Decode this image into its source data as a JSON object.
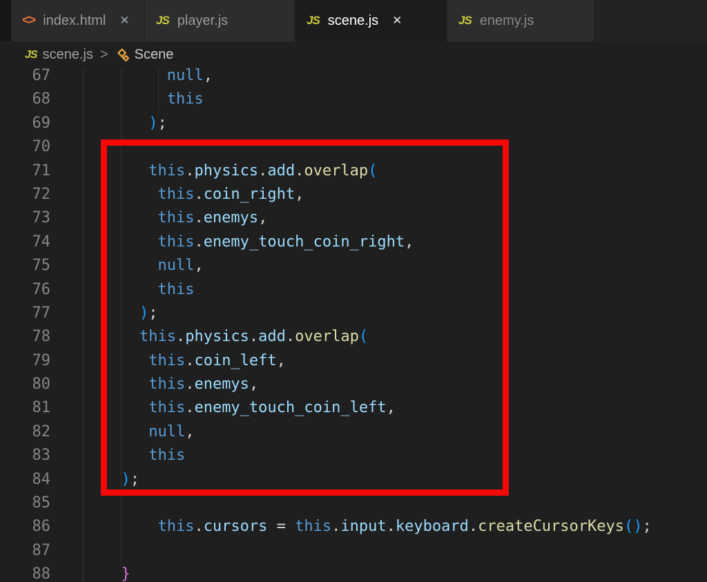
{
  "tab_bar": {
    "close_glyph": "✕",
    "js_icon_text": "JS",
    "html_icon_text": "<>",
    "tabs": [
      {
        "label": "index.html",
        "icon": "html-brackets",
        "close_visible": true,
        "active": false
      },
      {
        "label": "player.js",
        "icon": "js",
        "close_visible": false,
        "active": false
      },
      {
        "label": "scene.js",
        "icon": "js",
        "close_visible": true,
        "active": true
      },
      {
        "label": "enemy.js",
        "icon": "js",
        "close_visible": false,
        "active": false
      }
    ]
  },
  "breadcrumb": {
    "file_icon_text": "JS",
    "file_label": "scene.js",
    "chevron": ">",
    "symbol_label": "Scene"
  },
  "editor": {
    "background": "#1f1f1f",
    "line_number_color": "#858585",
    "first_visible_line": 67,
    "last_visible_line": 88,
    "token_colors": {
      "kw": "#569cd6",
      "prop": "#9cdcfe",
      "fn": "#dcdcaa",
      "pun": "#d4d4d4",
      "par": "#179fff",
      "brc": "#da70d6"
    },
    "lines": [
      {
        "num": 67,
        "indent": 11,
        "tokens": [
          [
            "kw",
            "null"
          ],
          [
            "pun",
            ","
          ]
        ]
      },
      {
        "num": 68,
        "indent": 11,
        "tokens": [
          [
            "kw",
            "this"
          ]
        ]
      },
      {
        "num": 69,
        "indent": 9,
        "tokens": [
          [
            "par",
            ")"
          ],
          [
            "pun",
            ";"
          ]
        ]
      },
      {
        "num": 70,
        "indent": 0,
        "tokens": []
      },
      {
        "num": 71,
        "indent": 9,
        "tokens": [
          [
            "kw",
            "this"
          ],
          [
            "pun",
            "."
          ],
          [
            "prop",
            "physics"
          ],
          [
            "pun",
            "."
          ],
          [
            "prop",
            "add"
          ],
          [
            "pun",
            "."
          ],
          [
            "fn",
            "overlap"
          ],
          [
            "par",
            "("
          ]
        ]
      },
      {
        "num": 72,
        "indent": 10,
        "tokens": [
          [
            "kw",
            "this"
          ],
          [
            "pun",
            "."
          ],
          [
            "prop",
            "coin_right"
          ],
          [
            "pun",
            ","
          ]
        ]
      },
      {
        "num": 73,
        "indent": 10,
        "tokens": [
          [
            "kw",
            "this"
          ],
          [
            "pun",
            "."
          ],
          [
            "prop",
            "enemys"
          ],
          [
            "pun",
            ","
          ]
        ]
      },
      {
        "num": 74,
        "indent": 10,
        "tokens": [
          [
            "kw",
            "this"
          ],
          [
            "pun",
            "."
          ],
          [
            "prop",
            "enemy_touch_coin_right"
          ],
          [
            "pun",
            ","
          ]
        ]
      },
      {
        "num": 75,
        "indent": 10,
        "tokens": [
          [
            "kw",
            "null"
          ],
          [
            "pun",
            ","
          ]
        ]
      },
      {
        "num": 76,
        "indent": 10,
        "tokens": [
          [
            "kw",
            "this"
          ]
        ]
      },
      {
        "num": 77,
        "indent": 8,
        "tokens": [
          [
            "par",
            ")"
          ],
          [
            "pun",
            ";"
          ]
        ]
      },
      {
        "num": 78,
        "indent": 8,
        "tokens": [
          [
            "kw",
            "this"
          ],
          [
            "pun",
            "."
          ],
          [
            "prop",
            "physics"
          ],
          [
            "pun",
            "."
          ],
          [
            "prop",
            "add"
          ],
          [
            "pun",
            "."
          ],
          [
            "fn",
            "overlap"
          ],
          [
            "par",
            "("
          ]
        ]
      },
      {
        "num": 79,
        "indent": 9,
        "tokens": [
          [
            "kw",
            "this"
          ],
          [
            "pun",
            "."
          ],
          [
            "prop",
            "coin_left"
          ],
          [
            "pun",
            ","
          ]
        ]
      },
      {
        "num": 80,
        "indent": 9,
        "tokens": [
          [
            "kw",
            "this"
          ],
          [
            "pun",
            "."
          ],
          [
            "prop",
            "enemys"
          ],
          [
            "pun",
            ","
          ]
        ]
      },
      {
        "num": 81,
        "indent": 9,
        "tokens": [
          [
            "kw",
            "this"
          ],
          [
            "pun",
            "."
          ],
          [
            "prop",
            "enemy_touch_coin_left"
          ],
          [
            "pun",
            ","
          ]
        ]
      },
      {
        "num": 82,
        "indent": 9,
        "tokens": [
          [
            "kw",
            "null"
          ],
          [
            "pun",
            ","
          ]
        ]
      },
      {
        "num": 83,
        "indent": 9,
        "tokens": [
          [
            "kw",
            "this"
          ]
        ]
      },
      {
        "num": 84,
        "indent": 6,
        "tokens": [
          [
            "par",
            ")"
          ],
          [
            "pun",
            ";"
          ]
        ]
      },
      {
        "num": 85,
        "indent": 0,
        "tokens": []
      },
      {
        "num": 86,
        "indent": 10,
        "tokens": [
          [
            "kw",
            "this"
          ],
          [
            "pun",
            "."
          ],
          [
            "prop",
            "cursors"
          ],
          [
            "pun",
            " = "
          ],
          [
            "kw",
            "this"
          ],
          [
            "pun",
            "."
          ],
          [
            "prop",
            "input"
          ],
          [
            "pun",
            "."
          ],
          [
            "prop",
            "keyboard"
          ],
          [
            "pun",
            "."
          ],
          [
            "fn",
            "createCursorKeys"
          ],
          [
            "par",
            "()"
          ],
          [
            "pun",
            ";"
          ]
        ]
      },
      {
        "num": 87,
        "indent": 0,
        "tokens": []
      },
      {
        "num": 88,
        "indent": 6,
        "tokens": [
          [
            "brc",
            "}"
          ]
        ]
      }
    ]
  },
  "annotation": {
    "type": "red-rectangle",
    "color": "#f70808",
    "encloses_lines": [
      70,
      84
    ]
  }
}
